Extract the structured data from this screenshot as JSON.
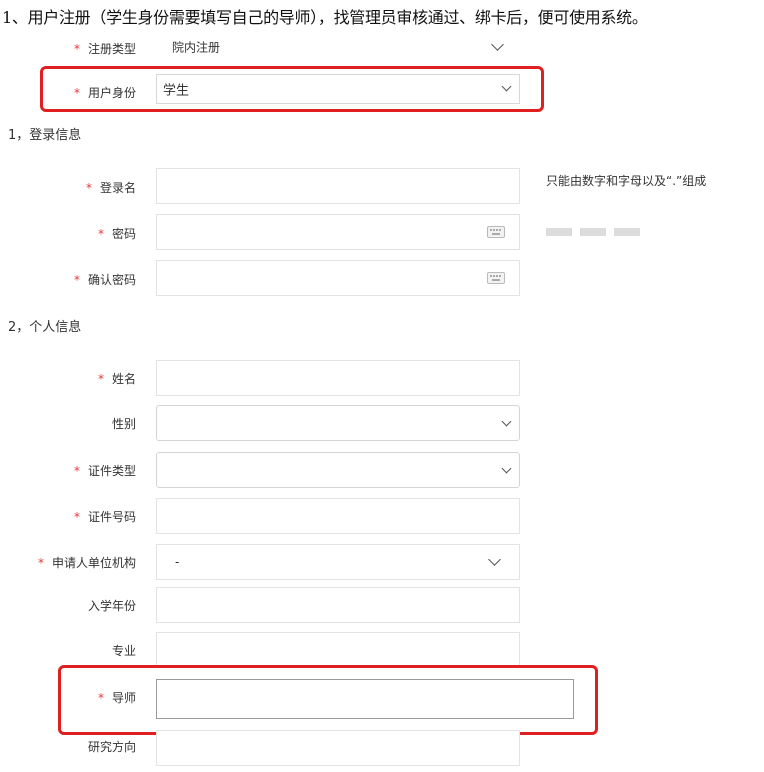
{
  "caption": "1、用户注册（学生身份需要填写自己的导师），找管理员审核通过、绑卡后，便可使用系统。",
  "required_mark": "*",
  "colors": {
    "required": "#e4393c",
    "highlight_box": "#e02020"
  },
  "fields": {
    "reg_type": {
      "label": "注册类型",
      "value": "院内注册"
    },
    "user_role": {
      "label": "用户身份",
      "value": "学生"
    },
    "section1": "1，登录信息",
    "login_name": {
      "label": "登录名",
      "value": ""
    },
    "login_hint": "只能由数字和字母以及“.”组成",
    "password": {
      "label": "密码",
      "value": ""
    },
    "confirm_password": {
      "label": "确认密码",
      "value": ""
    },
    "section2": "2，个人信息",
    "name": {
      "label": "姓名",
      "value": ""
    },
    "gender": {
      "label": "性别",
      "value": ""
    },
    "id_type": {
      "label": "证件类型",
      "value": ""
    },
    "id_number": {
      "label": "证件号码",
      "value": ""
    },
    "unit": {
      "label": "申请人单位机构",
      "value": "-"
    },
    "enroll_year": {
      "label": "入学年份",
      "value": ""
    },
    "major": {
      "label": "专业",
      "value": ""
    },
    "advisor": {
      "label": "导师",
      "value": ""
    },
    "research": {
      "label": "研究方向",
      "value": ""
    }
  },
  "icons": {
    "select": "chevron-down-icon",
    "password_keyboard": "keyboard-icon",
    "strength": "password-strength-meter"
  }
}
